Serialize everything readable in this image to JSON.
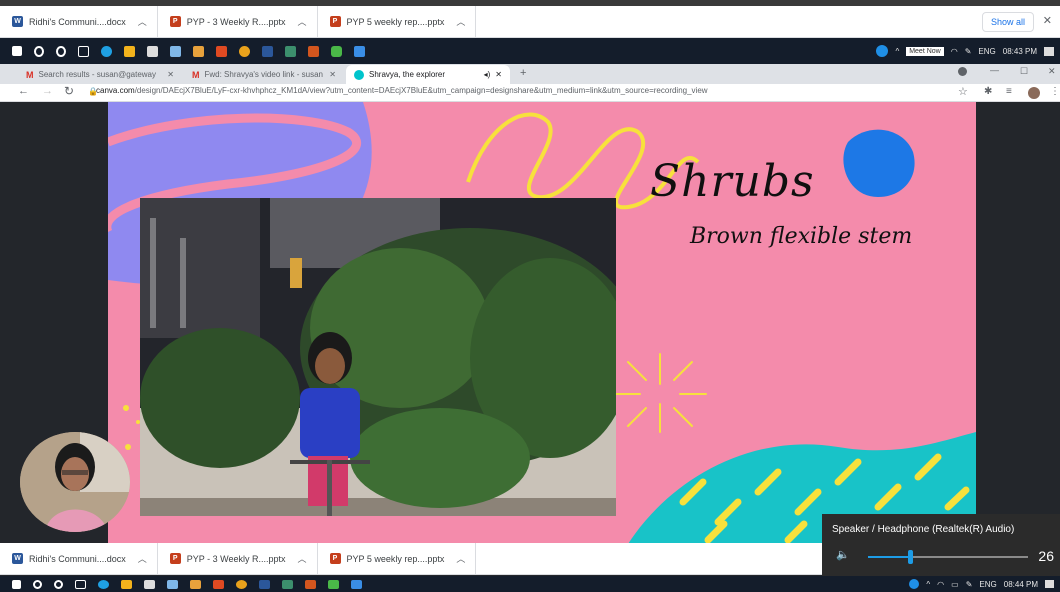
{
  "downloads_top": {
    "items": [
      {
        "name": "Ridhi's Communi....docx",
        "type": "docx"
      },
      {
        "name": "PYP - 3 Weekly R....pptx",
        "type": "pptx"
      },
      {
        "name": "PYP 5 weekly rep....pptx",
        "type": "pptx"
      }
    ],
    "show_all": "Show all",
    "close": "✕"
  },
  "taskbar_top": {
    "meet_now": "Meet Now",
    "lang": "ENG",
    "time": "08:43 PM"
  },
  "tabs": [
    {
      "title": "Search results - susan@gateway",
      "icon": "gmail-icon"
    },
    {
      "title": "Fwd: Shravya's video link - susan",
      "icon": "gmail-icon"
    },
    {
      "title": "Shravya, the explorer",
      "icon": "canva-icon"
    }
  ],
  "address": {
    "domain": "canva.com",
    "path": "/design/DAEcjX7BluE/LyF-cxr-khvhphcz_KM1dA/view?utm_content=DAEcjX7BluE&utm_campaign=designshare&utm_medium=link&utm_source=recording_view"
  },
  "slide": {
    "title": "Shrubs",
    "subtitle": "Brown flexible stem"
  },
  "downloads_bottom": {
    "items": [
      {
        "name": "Ridhi's Communi....docx",
        "type": "docx"
      },
      {
        "name": "PYP - 3 Weekly R....pptx",
        "type": "pptx"
      },
      {
        "name": "PYP 5 weekly rep....pptx",
        "type": "pptx"
      }
    ]
  },
  "volume": {
    "device": "Speaker / Headphone (Realtek(R) Audio)",
    "level": 26
  },
  "taskbar_bottom": {
    "lang": "ENG",
    "time": "08:44 PM"
  },
  "colors": {
    "slide_bg": "#f48bab",
    "accent_purple": "#8f89f0",
    "accent_teal": "#18c3c8",
    "accent_yellow": "#f7e13c",
    "blob_blue": "#1d78e6"
  }
}
